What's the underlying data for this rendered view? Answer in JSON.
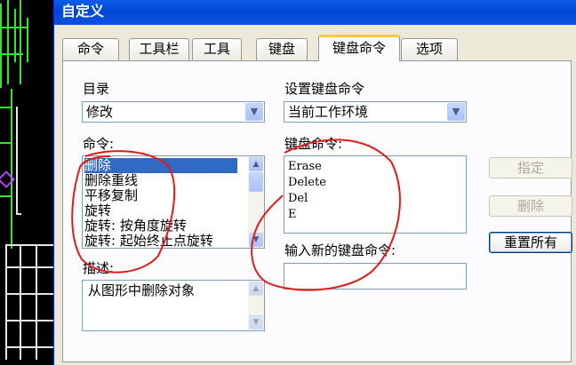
{
  "window": {
    "title": "自定义"
  },
  "tabs": [
    {
      "label": "命令",
      "active": false
    },
    {
      "label": "工具栏",
      "active": false
    },
    {
      "label": "工具",
      "active": false
    },
    {
      "label": "键盘",
      "active": false
    },
    {
      "label": "键盘命令",
      "active": true
    },
    {
      "label": "选项",
      "active": false
    }
  ],
  "left": {
    "category_label": "目录",
    "category_value": "修改",
    "commands_label": "命令:",
    "commands": [
      "删除",
      "删除重线",
      "平移复制",
      "旋转",
      "旋转: 按角度旋转",
      "旋转: 起始终止点旋转"
    ],
    "selected_index": 0,
    "description_label": "描述:",
    "description_text": "从图形中删除对象"
  },
  "right": {
    "set_label": "设置键盘命令",
    "set_value": "当前工作环境",
    "keys_label": "键盘命令:",
    "keys": [
      "Erase",
      "Delete",
      "Del",
      "E"
    ],
    "new_key_label": "输入新的键盘命令:",
    "new_key_value": ""
  },
  "buttons": {
    "assign": "指定",
    "delete": "删除",
    "reset_all": "重置所有"
  },
  "colors": {
    "annotation": "#e11a1a",
    "titlebar": "#0046d5",
    "selection": "#316ac5"
  },
  "icons": {
    "dropdown": "chevron-down-icon",
    "scroll_up": "chevron-up-icon",
    "scroll_down": "chevron-down-icon"
  }
}
